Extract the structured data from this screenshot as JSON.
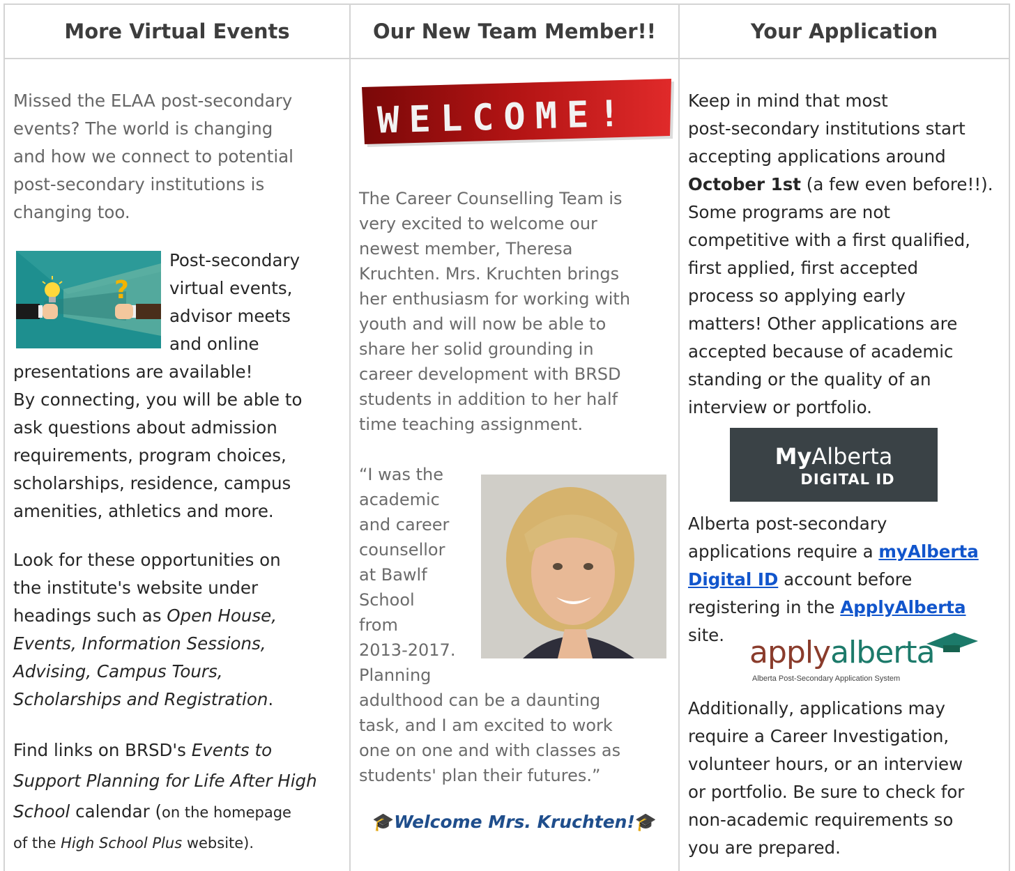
{
  "headers": [
    "More Virtual Events",
    "Our New Team Member!!",
    "Your Application"
  ],
  "col1": {
    "intro_lines": [
      "Missed the ELAA post-secondary",
      "events? The world is changing",
      "and how we connect to potential",
      "post-secondary institutions is",
      "changing too."
    ],
    "side_lines": [
      "Post-secondary",
      "virtual events,",
      "advisor meets",
      "and online"
    ],
    "main_lines": [
      "presentations are available!",
      "By connecting, you will be able to",
      "ask questions about admission",
      "requirements, program choices,",
      "scholarships, residence, campus",
      "amenities, athletics and more."
    ],
    "look": {
      "l1": "Look for these opportunities on",
      "l2": "the institute's website under",
      "l3a": "headings such as ",
      "l3b": "Open House,",
      "l4": "Events, Information Sessions,",
      "l5": "Advising, Campus Tours,",
      "l6a": "Scholarships and Registration",
      "l6b": "."
    },
    "find": {
      "l1a": "Find links on BRSD's ",
      "l1b": "Events to",
      "l2": "Support Planning for Life After High",
      "l3a": "School",
      "l3b": " calendar (",
      "l3c": "on the homepage",
      "l4a": "of the ",
      "l4b": "High School Plus",
      "l4c": " website)."
    }
  },
  "col2": {
    "welcome_banner": "WELCOME!",
    "para_lines": [
      "The Career Counselling Team is",
      "very excited to welcome our",
      "newest member, Theresa",
      "Kruchten. Mrs. Kruchten brings",
      "her enthusiasm for working with",
      "youth and will now be able to",
      "share her solid grounding in",
      "career development with BRSD",
      "students in addition to her half",
      "time teaching assignment."
    ],
    "quote_side_lines": [
      "“I was the",
      "academic",
      "and career",
      "counsellor",
      "at Bawlf",
      "School",
      "from",
      "2013-2017.",
      "Planning"
    ],
    "quote_lines": [
      "adulthood can be a daunting",
      "task, and I am excited to work",
      "one on one and with classes as",
      "students' plan their futures.”"
    ],
    "signoff": "Welcome Mrs. Kruchten!"
  },
  "col3": {
    "para1": {
      "l1": "Keep in mind that most",
      "l2": "post-secondary institutions start",
      "l3": "accepting applications around",
      "l4a": "October 1st",
      "l4b": " (a few even before!!).",
      "l5": "Some programs are not",
      "l6": "competitive with a first qualified,",
      "l7": "first applied, first accepted",
      "l8": "process so applying early",
      "l9": "matters! Other applications are",
      "l10": "accepted because of academic",
      "l11": "standing or the quality of an",
      "l12": "interview or portfolio."
    },
    "myalberta_logo": {
      "my": "My",
      "alberta": "Alberta",
      "digital": "DIGITAL ID"
    },
    "para2": {
      "l1": "Alberta post-secondary",
      "l2a": "applications require a ",
      "l2b": "myAlberta",
      "l3a": "Digital ID",
      "l3b": " account before",
      "l4a": "registering in the ",
      "l4b": "ApplyAlberta",
      "l5": "site."
    },
    "applyalberta_logo": {
      "apply": "apply",
      "alberta": "alberta",
      "tagline": "Alberta Post-Secondary Application System"
    },
    "para3_lines": [
      "Additionally, applications may",
      "require a Career Investigation,",
      "volunteer hours, or an interview",
      "or portfolio. Be sure to check for",
      "non-academic requirements so",
      "you are prepared."
    ]
  },
  "colors": {
    "link": "#1155cc",
    "signoff": "#1f4e8c",
    "banner": "#b01010",
    "border": "#d4d4d4"
  }
}
